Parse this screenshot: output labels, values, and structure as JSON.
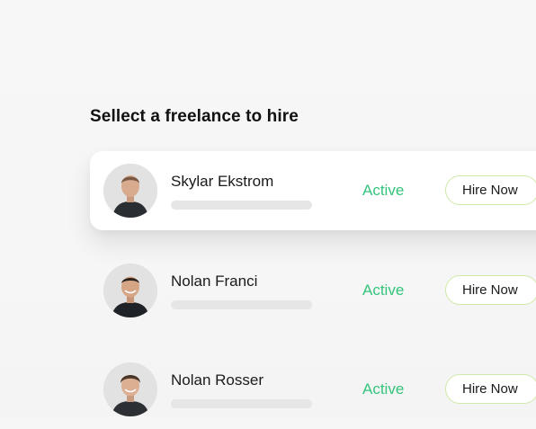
{
  "section": {
    "title": "Sellect a freelance to hire"
  },
  "freelancers": [
    {
      "name": "Skylar Ekstrom",
      "status": "Active",
      "action_label": "Hire Now",
      "highlighted": true
    },
    {
      "name": "Nolan Franci",
      "status": "Active",
      "action_label": "Hire Now",
      "highlighted": false
    },
    {
      "name": "Nolan Rosser",
      "status": "Active",
      "action_label": "Hire Now",
      "highlighted": false
    }
  ],
  "colors": {
    "status_active": "#34c47c",
    "button_border": "#cfe9a8",
    "background": "#f6f6f6",
    "card_highlight": "#ffffff"
  },
  "icons": {
    "avatar": "person-avatar-icon"
  }
}
